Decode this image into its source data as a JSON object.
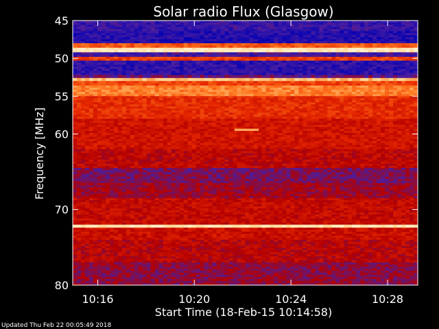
{
  "chart_data": {
    "type": "heatmap",
    "title": "Solar radio Flux (Glasgow)",
    "xlabel": "Start Time (18-Feb-15 10:14:58)",
    "ylabel": "Frequency [MHz]",
    "footer": "Updated Thu Feb 22 00:05:49 2018",
    "xlim": [
      10.2494,
      10.4875
    ],
    "ylim": [
      80,
      45
    ],
    "x_ticks": [
      {
        "label": "10:16",
        "value": 10.2667
      },
      {
        "label": "10:20",
        "value": 10.3333
      },
      {
        "label": "10:24",
        "value": 10.4
      },
      {
        "label": "10:28",
        "value": 10.4667
      }
    ],
    "y_ticks": [
      {
        "label": "45",
        "value": 45
      },
      {
        "label": "50",
        "value": 50
      },
      {
        "label": "55",
        "value": 55
      },
      {
        "label": "60",
        "value": 60
      },
      {
        "label": "70",
        "value": 70
      },
      {
        "label": "80",
        "value": 80
      }
    ],
    "colorscale": [
      "#0000b4",
      "#4a1ea0",
      "#b40000",
      "#e62800",
      "#ff7820",
      "#ffd28c",
      "#fff0c8"
    ],
    "bands": [
      {
        "f0": 45.0,
        "f1": 46.4,
        "level": 0.12
      },
      {
        "f0": 46.4,
        "f1": 48.0,
        "level": 0.08
      },
      {
        "f0": 48.0,
        "f1": 48.6,
        "level": 0.6
      },
      {
        "f0": 48.6,
        "f1": 49.2,
        "level": 0.95
      },
      {
        "f0": 49.2,
        "f1": 49.8,
        "level": 0.15
      },
      {
        "f0": 49.8,
        "f1": 50.3,
        "level": 0.55
      },
      {
        "f0": 50.3,
        "f1": 52.2,
        "level": 0.1
      },
      {
        "f0": 52.2,
        "f1": 52.6,
        "level": 0.22
      },
      {
        "f0": 52.6,
        "f1": 53.0,
        "level": 0.8
      },
      {
        "f0": 53.0,
        "f1": 53.6,
        "level": 0.55
      },
      {
        "f0": 53.6,
        "f1": 55.0,
        "level": 0.68
      },
      {
        "f0": 55.0,
        "f1": 58.0,
        "level": 0.5
      },
      {
        "f0": 58.0,
        "f1": 62.0,
        "level": 0.42
      },
      {
        "f0": 62.0,
        "f1": 64.5,
        "level": 0.36
      },
      {
        "f0": 64.5,
        "f1": 66.5,
        "level": 0.24
      },
      {
        "f0": 66.5,
        "f1": 68.5,
        "level": 0.3
      },
      {
        "f0": 68.5,
        "f1": 72.0,
        "level": 0.38
      },
      {
        "f0": 72.0,
        "f1": 72.4,
        "level": 0.92
      },
      {
        "f0": 72.4,
        "f1": 74.0,
        "level": 0.4
      },
      {
        "f0": 74.0,
        "f1": 77.0,
        "level": 0.35
      },
      {
        "f0": 77.0,
        "f1": 80.0,
        "level": 0.27
      }
    ],
    "events": [
      {
        "t0": 10.3611,
        "t1": 10.3778,
        "f0": 59.3,
        "f1": 59.6,
        "level": 0.75
      }
    ]
  }
}
